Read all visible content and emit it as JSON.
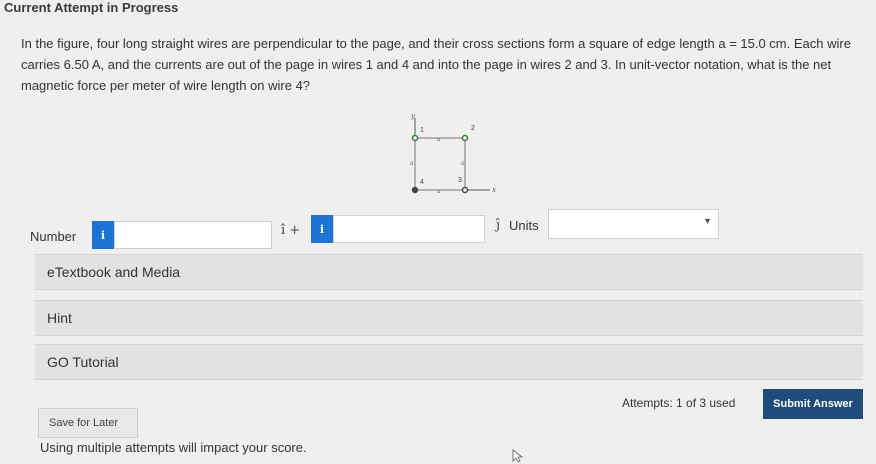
{
  "header": {
    "title": "Current Attempt in Progress"
  },
  "question": {
    "text": "In the figure, four long straight wires are perpendicular to the page, and their cross sections form a square of edge length a = 15.0 cm. Each wire carries 6.50 A, and the currents are out of the page in wires 1 and 4 and into the page in wires 2 and 3. In unit-vector notation, what is the net magnetic force per meter of wire length on wire 4?"
  },
  "figure": {
    "y_label": "y",
    "x_label": "x",
    "wire_labels": [
      "1",
      "2",
      "3",
      "4"
    ],
    "edge_label": "a"
  },
  "answer": {
    "number_label": "Number",
    "info_glyph": "i",
    "i_hat": "î +",
    "j_hat": "ĵ",
    "units_label": "Units",
    "input1_value": "",
    "input2_value": "",
    "units_value": ""
  },
  "panels": {
    "etextbook": "eTextbook and Media",
    "hint": "Hint",
    "go_tutorial": "GO Tutorial"
  },
  "footer": {
    "save_label": "Save for Later",
    "attempts_text": "Attempts: 1 of 3 used",
    "submit_label": "Submit Answer",
    "warning": "Using multiple attempts will impact your score."
  }
}
